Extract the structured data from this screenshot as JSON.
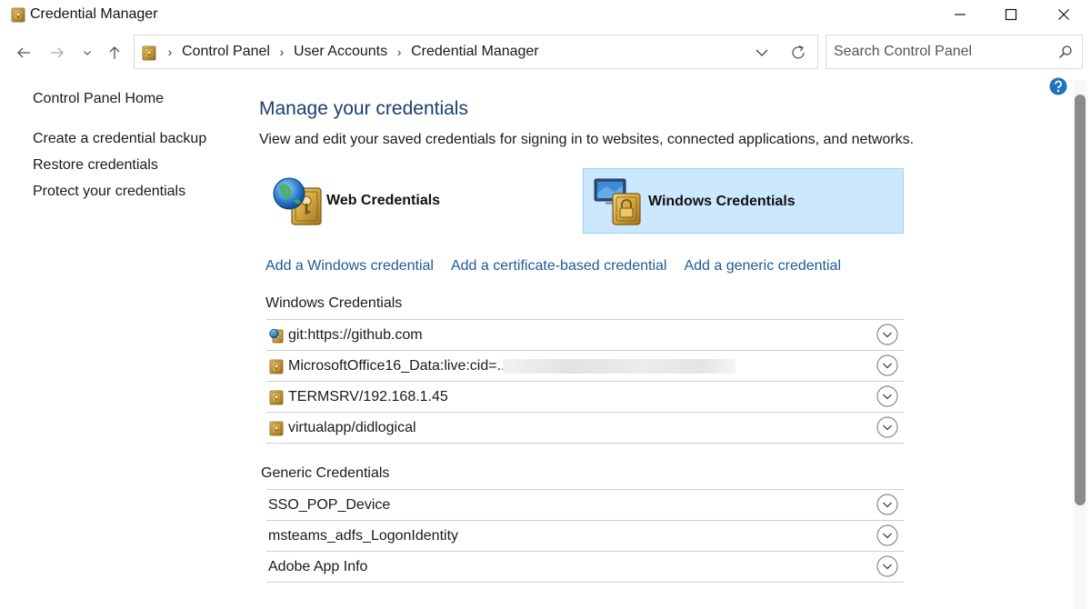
{
  "window": {
    "title": "Credential Manager",
    "icons": {
      "app": "credential-vault-icon",
      "minimize": "minimize-icon",
      "maximize": "maximize-icon",
      "close": "close-icon"
    }
  },
  "navigation": {
    "icons": [
      "back-arrow-icon",
      "forward-arrow-icon",
      "recent-dropdown-icon",
      "up-arrow-icon"
    ],
    "breadcrumbs": [
      "Control Panel",
      "User Accounts",
      "Credential Manager"
    ],
    "search_placeholder": "Search Control Panel"
  },
  "sidebar": {
    "home": "Control Panel Home",
    "links": [
      "Create a credential backup",
      "Restore credentials",
      "Protect your credentials"
    ]
  },
  "main": {
    "title": "Manage your credentials",
    "description": "View and edit your saved credentials for signing in to websites, connected applications, and networks.",
    "tiles": [
      {
        "label": "Web Credentials",
        "icon": "web-credentials-icon",
        "selected": false
      },
      {
        "label": "Windows Credentials",
        "icon": "windows-credentials-icon",
        "selected": true
      }
    ],
    "add_links": [
      "Add a Windows credential",
      "Add a certificate-based credential",
      "Add a generic credential"
    ],
    "windows_section": {
      "heading": "Windows Credentials",
      "items": [
        {
          "name": "git:https://github.com",
          "icon": "globe-vault-icon"
        },
        {
          "name": "MicrosoftOffice16_Data:live:cid=...",
          "icon": "vault-icon",
          "redacted": true
        },
        {
          "name": "TERMSRV/192.168.1.45",
          "icon": "vault-icon"
        },
        {
          "name": "virtualapp/didlogical",
          "icon": "vault-icon"
        }
      ]
    },
    "generic_section": {
      "heading": "Generic Credentials",
      "items": [
        {
          "name": "SSO_POP_Device"
        },
        {
          "name": "msteams_adfs_LogonIdentity"
        },
        {
          "name": "Adobe App Info"
        }
      ]
    }
  },
  "colors": {
    "heading_blue": "#1c3f6e",
    "link_blue": "#1f5a96",
    "selected_tile_bg": "#cce8ff",
    "selected_tile_border": "#99d1ff",
    "help_blue": "#1e73be"
  }
}
